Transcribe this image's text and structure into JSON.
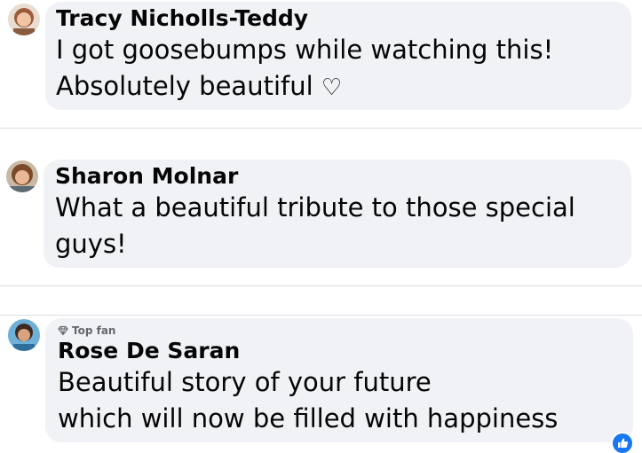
{
  "comments": [
    {
      "author": "Tracy Nicholls-Teddy",
      "line1": "I got goosebumps while watching this!",
      "line2": "Absolutely beautiful",
      "emoji": "♡"
    },
    {
      "author": "Sharon Molnar",
      "line1": "What a beautiful tribute to those special",
      "line2": "guys!"
    },
    {
      "badge": "Top fan",
      "author": "Rose De Saran",
      "line1": "Beautiful story of your future",
      "line2": "which will now be filled with happiness"
    }
  ],
  "colors": {
    "bubble": "#f0f2f5",
    "text": "#050505",
    "meta": "#65676b",
    "accent": "#1877f2"
  },
  "icons": {
    "badge": "diamond-icon",
    "reaction": "like-icon"
  }
}
